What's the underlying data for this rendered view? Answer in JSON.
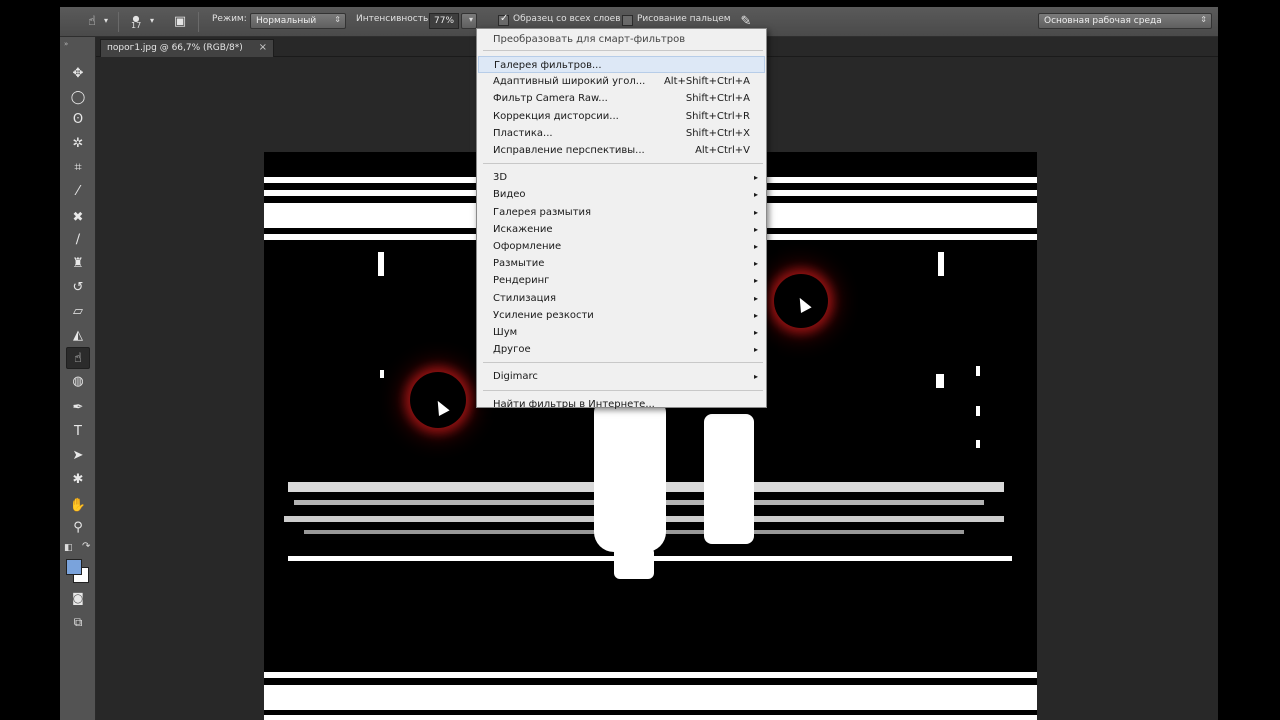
{
  "options_bar": {
    "brush_size": "17",
    "mode_label": "Режим:",
    "mode_value": "Нормальный",
    "strength_label": "Интенсивность:",
    "strength_value": "77%",
    "sample_all_layers_label": "Образец со всех слоев",
    "sample_all_layers_checked": true,
    "finger_painting_label": "Рисование пальцем",
    "finger_painting_checked": false,
    "workspace_value": "Основная рабочая среда"
  },
  "document_tab": {
    "title": "порог1.jpg @ 66,7% (RGB/8*)",
    "close": "×"
  },
  "tools": [
    {
      "name": "move-tool",
      "glyph": "✥"
    },
    {
      "name": "elliptical-marquee-tool",
      "glyph": "◯"
    },
    {
      "name": "lasso-tool",
      "glyph": "ʘ"
    },
    {
      "name": "magic-wand-tool",
      "glyph": "✲"
    },
    {
      "name": "crop-tool",
      "glyph": "⌗"
    },
    {
      "name": "eyedropper-tool",
      "glyph": "⁄"
    },
    {
      "name": "healing-brush-tool",
      "glyph": "✖"
    },
    {
      "name": "brush-tool",
      "glyph": "∕"
    },
    {
      "name": "clone-stamp-tool",
      "glyph": "♜"
    },
    {
      "name": "history-brush-tool",
      "glyph": "↺"
    },
    {
      "name": "eraser-tool",
      "glyph": "▱"
    },
    {
      "name": "paint-bucket-tool",
      "glyph": "◭"
    },
    {
      "name": "smudge-tool",
      "glyph": "☝",
      "active": true
    },
    {
      "name": "sponge-tool",
      "glyph": "◍"
    },
    {
      "name": "pen-tool",
      "glyph": "✒"
    },
    {
      "name": "type-tool",
      "glyph": "T"
    },
    {
      "name": "path-selection-tool",
      "glyph": "➤"
    },
    {
      "name": "custom-shape-tool",
      "glyph": "✱"
    },
    {
      "name": "hand-tool",
      "glyph": "✋"
    },
    {
      "name": "zoom-tool",
      "glyph": "⚲"
    }
  ],
  "colors": {
    "foreground": "#7aa3dc",
    "background": "#ffffff",
    "glow": "#a01414"
  },
  "menu": {
    "top_partial": "Преобразовать для смарт-фильтров",
    "group1": [
      {
        "label": "Галерея фильтров...",
        "shortcut": "",
        "highlighted": true
      },
      {
        "label": "Адаптивный широкий угол...",
        "shortcut": "Alt+Shift+Ctrl+A"
      },
      {
        "label": "Фильтр Camera Raw...",
        "shortcut": "Shift+Ctrl+A"
      },
      {
        "label": "Коррекция дисторсии...",
        "shortcut": "Shift+Ctrl+R"
      },
      {
        "label": "Пластика...",
        "shortcut": "Shift+Ctrl+X"
      },
      {
        "label": "Исправление перспективы...",
        "shortcut": "Alt+Ctrl+V"
      }
    ],
    "group2": [
      {
        "label": "3D"
      },
      {
        "label": "Видео"
      },
      {
        "label": "Галерея размытия"
      },
      {
        "label": "Искажение"
      },
      {
        "label": "Оформление"
      },
      {
        "label": "Размытие"
      },
      {
        "label": "Рендеринг"
      },
      {
        "label": "Стилизация"
      },
      {
        "label": "Усиление резкости"
      },
      {
        "label": "Шум"
      },
      {
        "label": "Другое"
      }
    ],
    "group3": [
      {
        "label": "Digimarc"
      }
    ],
    "group4": [
      {
        "label": "Найти фильтры в Интернете..."
      }
    ],
    "submenu_arrow": "▸"
  }
}
